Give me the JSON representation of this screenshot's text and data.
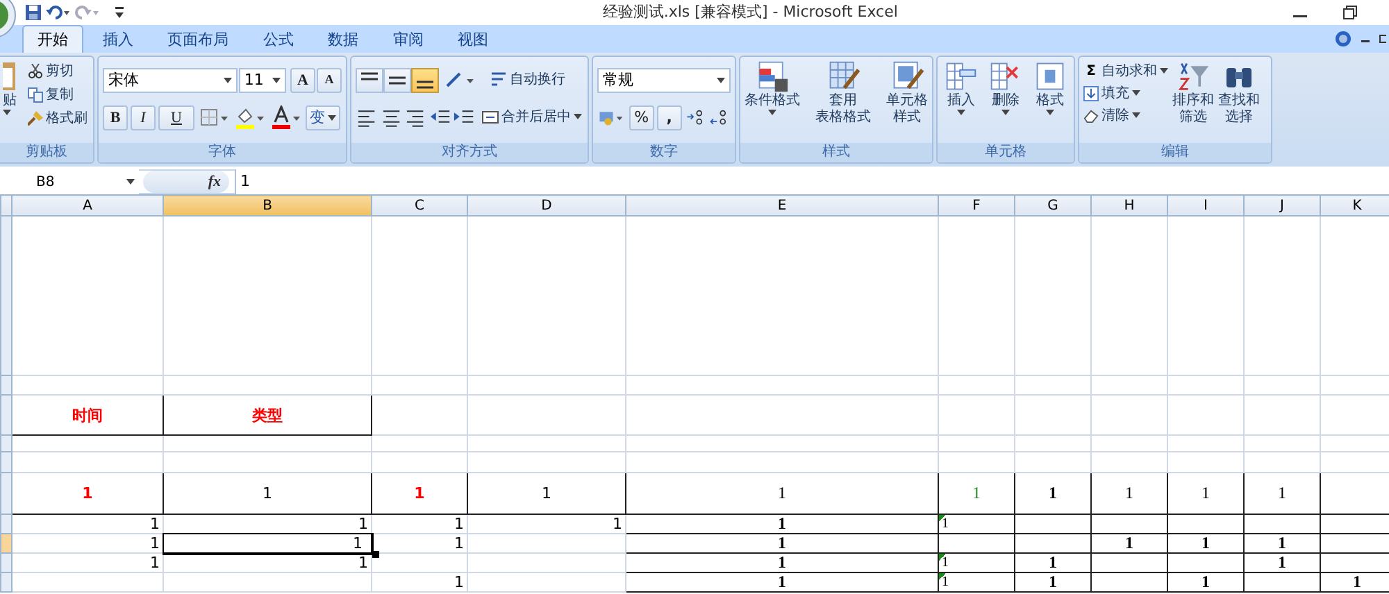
{
  "title_bar": {
    "title": "经验测试.xls  [兼容模式] - Microsoft Excel"
  },
  "tabs": [
    {
      "label": "开始",
      "selected": true
    },
    {
      "label": "插入",
      "selected": false
    },
    {
      "label": "页面布局",
      "selected": false
    },
    {
      "label": "公式",
      "selected": false
    },
    {
      "label": "数据",
      "selected": false
    },
    {
      "label": "审阅",
      "selected": false
    },
    {
      "label": "视图",
      "selected": false
    }
  ],
  "ribbon": {
    "clipboard": {
      "paste": "贴",
      "cut": "剪切",
      "copy": "复制",
      "format_painter": "格式刷",
      "label": "剪贴板"
    },
    "font": {
      "name": "宋体",
      "size": "11",
      "grow": "A",
      "shrink": "A",
      "bold": "B",
      "italic": "I",
      "underline": "U",
      "phonetic": "变",
      "label": "字体"
    },
    "alignment": {
      "vertical": [
        {
          "selected": false
        },
        {
          "selected": false
        },
        {
          "selected": true
        }
      ],
      "wrap": "自动换行",
      "merge": "合并后居中",
      "label": "对齐方式"
    },
    "number": {
      "format": "常规",
      "percent": "%",
      "comma": ",",
      "label": "数字"
    },
    "styles": {
      "conditional": [
        "条件格式"
      ],
      "table": [
        "套用",
        "表格格式"
      ],
      "cell_styles": [
        "单元格",
        "样式"
      ],
      "label": "样式"
    },
    "cells": {
      "insert": "插入",
      "delete": "删除",
      "format": "格式",
      "label": "单元格"
    },
    "editing": {
      "sum_sign": "Σ",
      "autosum": "自动求和",
      "fill": "填充",
      "clear": "清除",
      "sort": [
        "排序和",
        "筛选"
      ],
      "find": [
        "查找和",
        "选择"
      ],
      "label": "编辑"
    }
  },
  "formula_bar": {
    "name_box": "B8",
    "fx": "fx",
    "value": "1"
  },
  "columns": [
    {
      "label": "A",
      "selected": false
    },
    {
      "label": "B",
      "selected": true
    },
    {
      "label": "C",
      "selected": false
    },
    {
      "label": "D",
      "selected": false
    },
    {
      "label": "E",
      "selected": false
    },
    {
      "label": "F",
      "selected": false
    },
    {
      "label": "G",
      "selected": false
    },
    {
      "label": "H",
      "selected": false
    },
    {
      "label": "I",
      "selected": false
    },
    {
      "label": "J",
      "selected": false
    },
    {
      "label": "K",
      "selected": false
    }
  ],
  "rows": [
    {
      "selected": false,
      "kind": "plain"
    },
    {
      "selected": false,
      "kind": "plain"
    },
    {
      "selected": false,
      "kind": "title-box",
      "cells": [
        {
          "text": "时间",
          "kind": "heading"
        },
        {
          "text": "类型",
          "kind": "heading"
        },
        {
          "kind": "empty"
        },
        {
          "kind": "empty"
        },
        {
          "kind": "empty"
        },
        {
          "kind": "empty"
        },
        {
          "kind": "empty"
        },
        {
          "kind": "empty"
        },
        {
          "kind": "empty"
        },
        {
          "kind": "empty"
        },
        {
          "kind": "empty"
        }
      ]
    },
    {
      "selected": false,
      "kind": "plain"
    },
    {
      "selected": false,
      "kind": "plain"
    },
    {
      "selected": false,
      "kind": "full-box",
      "cells": [
        {
          "text": "1",
          "kind": "heading"
        },
        {
          "text": "1",
          "kind": "centered"
        },
        {
          "text": "1",
          "kind": "heading"
        },
        {
          "text": "1",
          "kind": "centered"
        },
        {
          "text": "1",
          "kind": "serif"
        },
        {
          "text": "1",
          "kind": "green"
        },
        {
          "text": "1",
          "kind": "serif-bold"
        },
        {
          "text": "1",
          "kind": "serif"
        },
        {
          "text": "1",
          "kind": "serif"
        },
        {
          "text": "1",
          "kind": "serif"
        },
        {
          "kind": "empty"
        }
      ]
    },
    {
      "selected": false,
      "kind": "right-box",
      "cells": [
        {
          "text": "1",
          "kind": "number"
        },
        {
          "text": "1",
          "kind": "number"
        },
        {
          "text": "1",
          "kind": "number"
        },
        {
          "text": "1",
          "kind": "number"
        },
        {
          "text": "1",
          "kind": "serif-bold"
        },
        {
          "text": "1",
          "kind": "flagged"
        },
        {
          "kind": "empty"
        },
        {
          "kind": "empty"
        },
        {
          "kind": "empty"
        },
        {
          "kind": "empty"
        },
        {
          "kind": "empty"
        }
      ]
    },
    {
      "selected": true,
      "kind": "right-box",
      "cells": [
        {
          "text": "1",
          "kind": "number"
        },
        {
          "text": "1",
          "kind": "number"
        },
        {
          "text": "1",
          "kind": "number"
        },
        {
          "kind": "empty"
        },
        {
          "text": "1",
          "kind": "serif-bold"
        },
        {
          "kind": "empty"
        },
        {
          "kind": "empty"
        },
        {
          "text": "1",
          "kind": "serif-bold"
        },
        {
          "text": "1",
          "kind": "serif-bold"
        },
        {
          "text": "1",
          "kind": "serif-bold"
        },
        {
          "kind": "empty"
        }
      ]
    },
    {
      "selected": false,
      "kind": "right-box",
      "cells": [
        {
          "text": "1",
          "kind": "number"
        },
        {
          "text": "1",
          "kind": "number"
        },
        {
          "kind": "empty"
        },
        {
          "kind": "empty"
        },
        {
          "text": "1",
          "kind": "serif-bold"
        },
        {
          "text": "1",
          "kind": "flagged"
        },
        {
          "text": "1",
          "kind": "serif-bold"
        },
        {
          "kind": "empty"
        },
        {
          "kind": "empty"
        },
        {
          "text": "1",
          "kind": "serif-bold"
        },
        {
          "kind": "empty"
        }
      ]
    },
    {
      "selected": false,
      "kind": "right-box",
      "cells": [
        {
          "kind": "empty"
        },
        {
          "kind": "empty"
        },
        {
          "text": "1",
          "kind": "number"
        },
        {
          "kind": "empty"
        },
        {
          "text": "1",
          "kind": "serif-bold"
        },
        {
          "text": "1",
          "kind": "flagged"
        },
        {
          "text": "1",
          "kind": "serif-bold"
        },
        {
          "kind": "empty"
        },
        {
          "text": "1",
          "kind": "serif-bold"
        },
        {
          "kind": "empty"
        },
        {
          "text": "1",
          "kind": "serif-bold"
        }
      ]
    }
  ]
}
